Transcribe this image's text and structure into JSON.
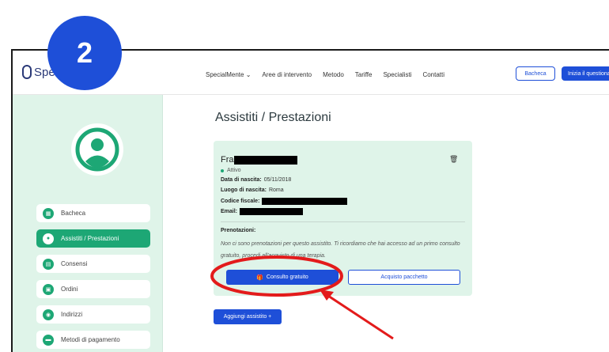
{
  "step_badge": "2",
  "brand": {
    "name": "Speci"
  },
  "nav": {
    "links": [
      "SpecialMente ⌄",
      "Aree di intervento",
      "Metodo",
      "Tariffe",
      "Specialisti",
      "Contatti"
    ],
    "bacheca_button": "Bacheca",
    "primary_button": "Inizia il questionario"
  },
  "sidebar": {
    "items": [
      {
        "label": "Bacheca",
        "icon": "dashboard-icon",
        "active": false
      },
      {
        "label": "Assistiti / Prestazioni",
        "icon": "people-icon",
        "active": true
      },
      {
        "label": "Consensi",
        "icon": "document-icon",
        "active": false
      },
      {
        "label": "Ordini",
        "icon": "orders-icon",
        "active": false
      },
      {
        "label": "Indirizzi",
        "icon": "location-pin-icon",
        "active": false
      },
      {
        "label": "Metodi di pagamento",
        "icon": "card-icon",
        "active": false
      }
    ]
  },
  "main": {
    "title": "Assistiti / Prestazioni",
    "card": {
      "name_prefix": "Fra",
      "status": "Attivo",
      "birth_date_label": "Data di nascita:",
      "birth_date_value": "05/11/2018",
      "birth_place_label": "Luogo di nascita:",
      "birth_place_value": "Roma",
      "fiscal_code_label": "Codice fiscale:",
      "email_label": "Email:",
      "bookings_label": "Prenotazioni:",
      "bookings_text": "Non ci sono prenotazioni per questo assistito. Ti ricordiamo che hai accesso ad un primo consulto gratuito, procedi all'acquisto di una terapia.",
      "free_consult_button": "Consulto gratuito",
      "buy_package_button": "Acquisto pacchetto"
    },
    "add_button": "Aggiungi assistito +"
  },
  "colors": {
    "accent_blue": "#1e4fd8",
    "accent_green": "#1da775",
    "mint_bg": "#dff4e9",
    "highlight_red": "#e31b1b"
  }
}
